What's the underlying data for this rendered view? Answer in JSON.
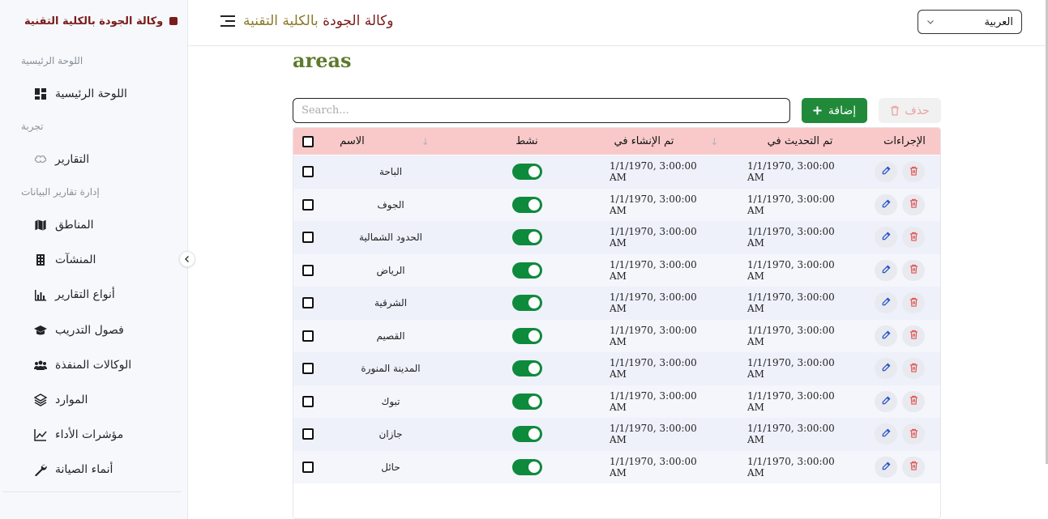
{
  "brand": {
    "title": "وكالة الجودة بالكلية التقنية"
  },
  "sidebar": {
    "sections": [
      {
        "label": "اللوحة الرئيسية"
      },
      {
        "label": "تجربة"
      },
      {
        "label": "إدارة تقارير البيانات"
      }
    ],
    "items": [
      {
        "label": "اللوحة الرئيسية",
        "icon": "dashboard-icon"
      },
      {
        "label": "التقارير",
        "icon": "brain-icon"
      },
      {
        "label": "المناطق",
        "icon": "map-icon"
      },
      {
        "label": "المنشآت",
        "icon": "building-icon"
      },
      {
        "label": "أنواع التقارير",
        "icon": "bar-chart-icon"
      },
      {
        "label": "فصول التدريب",
        "icon": "graduation-cap-icon"
      },
      {
        "label": "الوكالات المنفذة",
        "icon": "users-icon"
      },
      {
        "label": "الموارد",
        "icon": "layers-icon"
      },
      {
        "label": "مؤشرات الأداء",
        "icon": "line-chart-icon"
      },
      {
        "label": "أنماء الصيانة",
        "icon": "wrench-icon"
      }
    ]
  },
  "header": {
    "title_main": "وكالة الجودة",
    "title_accent": "بالكلية التقنية",
    "language": "العربية"
  },
  "page": {
    "title": "areas",
    "delete_label": "حذف",
    "add_label": "إضافة",
    "search_placeholder": "Search..."
  },
  "table": {
    "headers": {
      "name": "الاسم",
      "active": "نشط",
      "created": "تم الإنشاء في",
      "updated": "تم التحديث في",
      "actions": "الإجراءات"
    },
    "rows": [
      {
        "name": "الباحة",
        "created": "1/1/1970, 3:00:00 AM",
        "updated": "1/1/1970, 3:00:00 AM",
        "active": true
      },
      {
        "name": "الجوف",
        "created": "1/1/1970, 3:00:00 AM",
        "updated": "1/1/1970, 3:00:00 AM",
        "active": true
      },
      {
        "name": "الحدود الشمالية",
        "created": "1/1/1970, 3:00:00 AM",
        "updated": "1/1/1970, 3:00:00 AM",
        "active": true
      },
      {
        "name": "الرياض",
        "created": "1/1/1970, 3:00:00 AM",
        "updated": "1/1/1970, 3:00:00 AM",
        "active": true
      },
      {
        "name": "الشرقية",
        "created": "1/1/1970, 3:00:00 AM",
        "updated": "1/1/1970, 3:00:00 AM",
        "active": true
      },
      {
        "name": "القصيم",
        "created": "1/1/1970, 3:00:00 AM",
        "updated": "1/1/1970, 3:00:00 AM",
        "active": true
      },
      {
        "name": "المدينة المنورة",
        "created": "1/1/1970, 3:00:00 AM",
        "updated": "1/1/1970, 3:00:00 AM",
        "active": true
      },
      {
        "name": "تبوك",
        "created": "1/1/1970, 3:00:00 AM",
        "updated": "1/1/1970, 3:00:00 AM",
        "active": true
      },
      {
        "name": "جازان",
        "created": "1/1/1970, 3:00:00 AM",
        "updated": "1/1/1970, 3:00:00 AM",
        "active": true
      },
      {
        "name": "حائل",
        "created": "1/1/1970, 3:00:00 AM",
        "updated": "1/1/1970, 3:00:00 AM",
        "active": true
      }
    ]
  }
}
